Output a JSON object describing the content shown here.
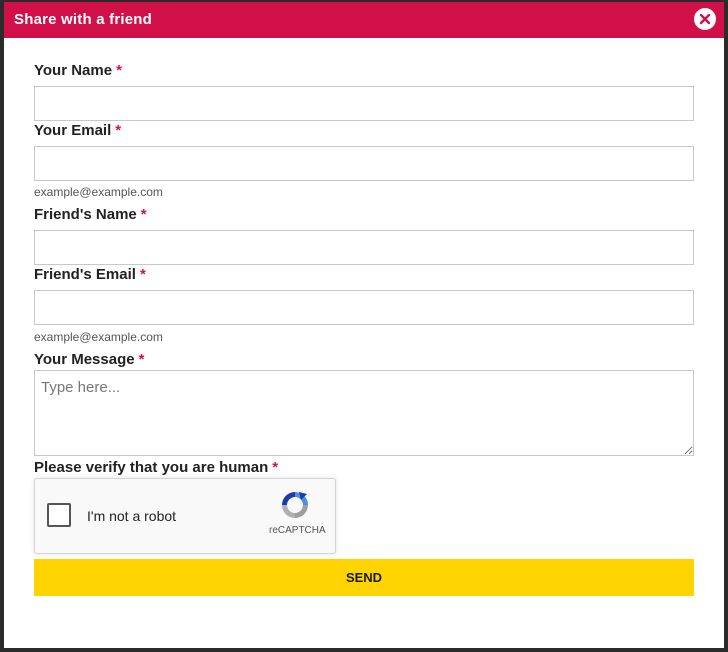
{
  "modal": {
    "title": "Share with a friend",
    "close_icon": "close-icon"
  },
  "fields": {
    "your_name": {
      "label": "Your Name",
      "required_mark": "*",
      "value": ""
    },
    "your_email": {
      "label": "Your Email",
      "required_mark": "*",
      "value": "",
      "hint": "example@example.com"
    },
    "friend_name": {
      "label": "Friend's Name",
      "required_mark": "*",
      "value": ""
    },
    "friend_email": {
      "label": "Friend's Email",
      "required_mark": "*",
      "value": "",
      "hint": "example@example.com"
    },
    "message": {
      "label": "Your Message",
      "required_mark": "*",
      "placeholder": "Type here...",
      "value": ""
    }
  },
  "captcha": {
    "label": "Please verify that you are human",
    "required_mark": "*",
    "checkbox_label": "I'm not a robot",
    "brand": "reCAPTCHA",
    "checked": false
  },
  "actions": {
    "send_label": "SEND"
  },
  "colors": {
    "header": "#d1104a",
    "required": "#d1104a",
    "send_button": "#ffd400"
  }
}
